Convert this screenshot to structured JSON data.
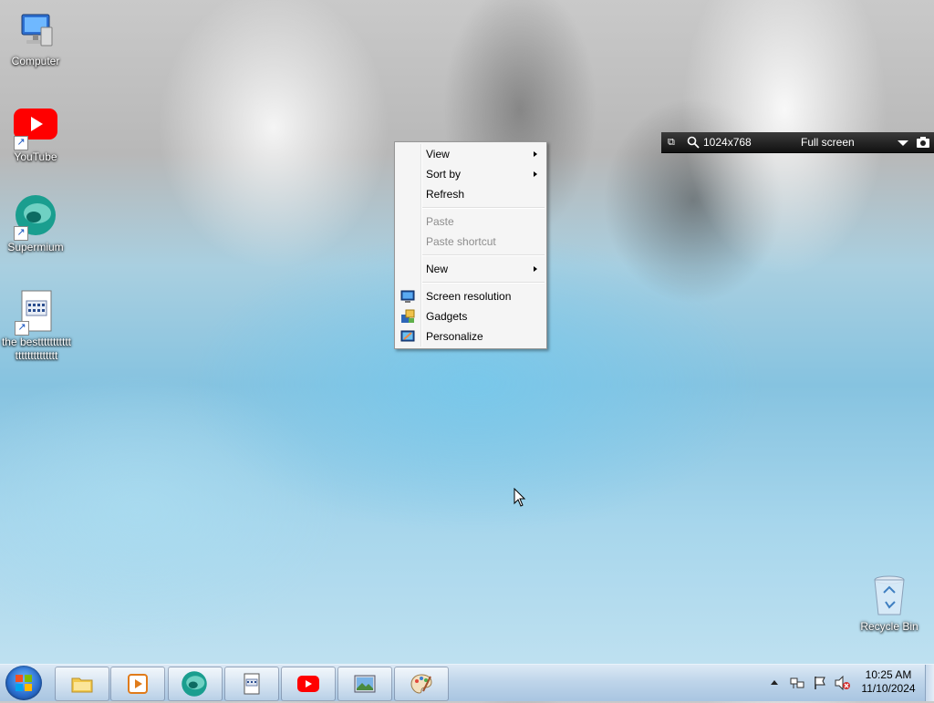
{
  "desktop": {
    "icons": [
      {
        "label": "Computer"
      },
      {
        "label": "YouTube"
      },
      {
        "label": "Supermium"
      },
      {
        "label": "the besttttttttttttttttttttttttt"
      },
      {
        "label": "Recycle Bin"
      }
    ]
  },
  "context_menu": {
    "items": [
      {
        "label": "View"
      },
      {
        "label": "Sort by"
      },
      {
        "label": "Refresh"
      },
      {
        "label": "Paste"
      },
      {
        "label": "Paste shortcut"
      },
      {
        "label": "New"
      },
      {
        "label": "Screen resolution"
      },
      {
        "label": "Gadgets"
      },
      {
        "label": "Personalize"
      }
    ]
  },
  "zoombar": {
    "resolution": "1024x768",
    "mode": "Full screen"
  },
  "taskbar": {
    "clock_time": "10:25 AM",
    "clock_date": "11/10/2024"
  },
  "colors": {
    "youtube_red": "#ff0000",
    "supermium_teal": "#1a9e8f",
    "taskbar_blue": "#bfd5ea"
  }
}
